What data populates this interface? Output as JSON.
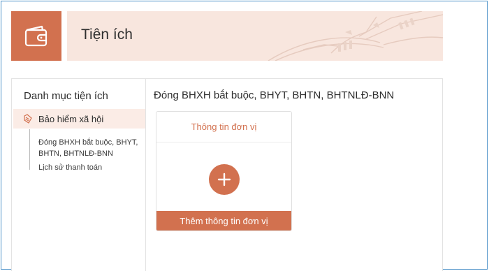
{
  "header": {
    "title": "Tiện ích",
    "icon": "wallet-icon",
    "accent_color": "#d2714f",
    "banner_color": "#f8e6de"
  },
  "sidebar": {
    "title": "Danh mục tiện ích",
    "category": {
      "label": "Bảo hiểm xã hội",
      "icon": "insurance-icon"
    },
    "sub_items": [
      {
        "label": "Đóng BHXH bắt buộc, BHYT, BHTN, BHTNLĐ-BNN"
      },
      {
        "label": "Lịch sử thanh toán"
      }
    ]
  },
  "content": {
    "title": "Đóng BHXH bắt buộc, BHYT, BHTN, BHTNLĐ-BNN",
    "card": {
      "header": "Thông tin đơn vị",
      "add_icon": "plus-icon",
      "footer_button": "Thêm thông tin đơn vị"
    }
  }
}
